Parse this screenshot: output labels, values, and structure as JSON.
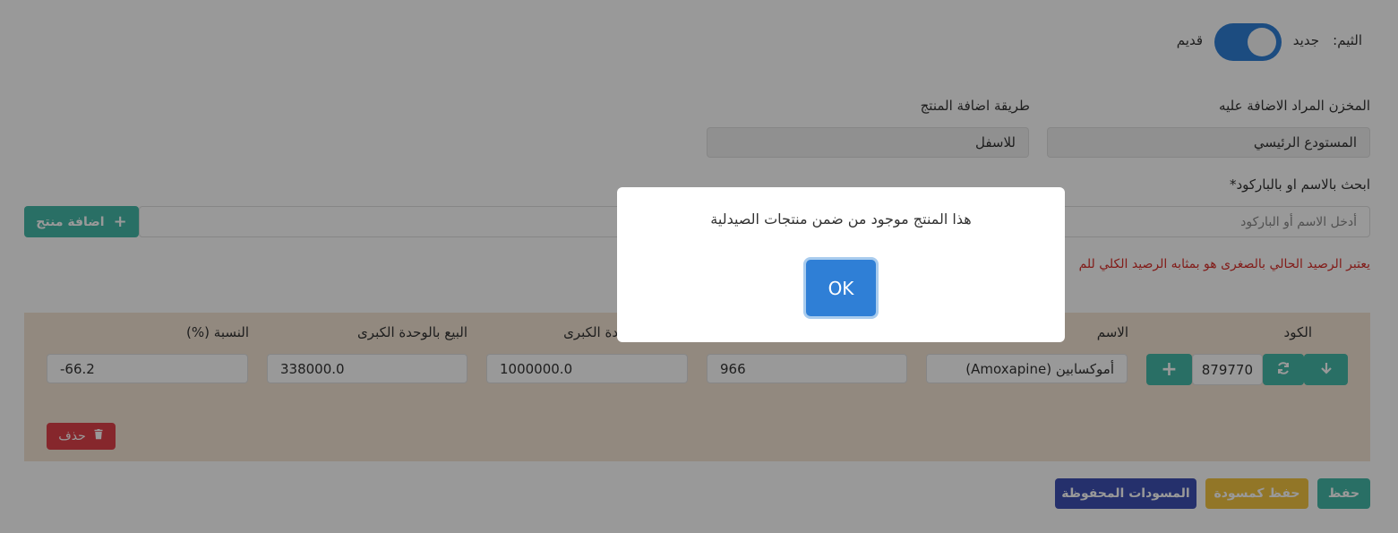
{
  "theme": {
    "label": "الثيم:",
    "new_label": "جديد",
    "old_label": "قديم",
    "toggle_on": true
  },
  "warehouse": {
    "label": "المخزن المراد الاضافة عليه",
    "value": "المستودع الرئيسي"
  },
  "add_method": {
    "label": "طريقة اضافة المنتج",
    "value": "للاسفل"
  },
  "search": {
    "label": "ابحث بالاسم او بالباركود*",
    "placeholder": "أدخل الاسم أو الباركود",
    "add_button": "اضافة منتج"
  },
  "note": {
    "text": "يعتبر الرصيد الحالي بالصغرى هو بمثابه الرصيد الكلي للم"
  },
  "table": {
    "headers": {
      "code": "الكود",
      "name": "الاسم",
      "big_unit_price": "دة الكبرى",
      "sell_big_unit": "البيع بالوحدة الكبرى",
      "ratio": "النسبة (%)"
    },
    "row": {
      "code": "879770",
      "name": "أموكسابين (Amoxapine)",
      "qty": "966",
      "big_unit_price": "1000000.0",
      "sell_big_unit": "338000.0",
      "ratio": "-66.2"
    },
    "delete_button": "حذف"
  },
  "footer": {
    "save": "حفظ",
    "save_draft": "حفظ كمسودة",
    "saved_drafts": "المسودات المحفوظة"
  },
  "dialog": {
    "message": "هذا المنتج موجود من ضمن منتجات الصيدلية",
    "ok": "OK"
  },
  "colors": {
    "teal": "#45b9a8",
    "yellow": "#f4c542",
    "indigo": "#3f51b5",
    "red": "#e0414a",
    "toggle": "#2f7fd6",
    "note": "#d9302b"
  }
}
